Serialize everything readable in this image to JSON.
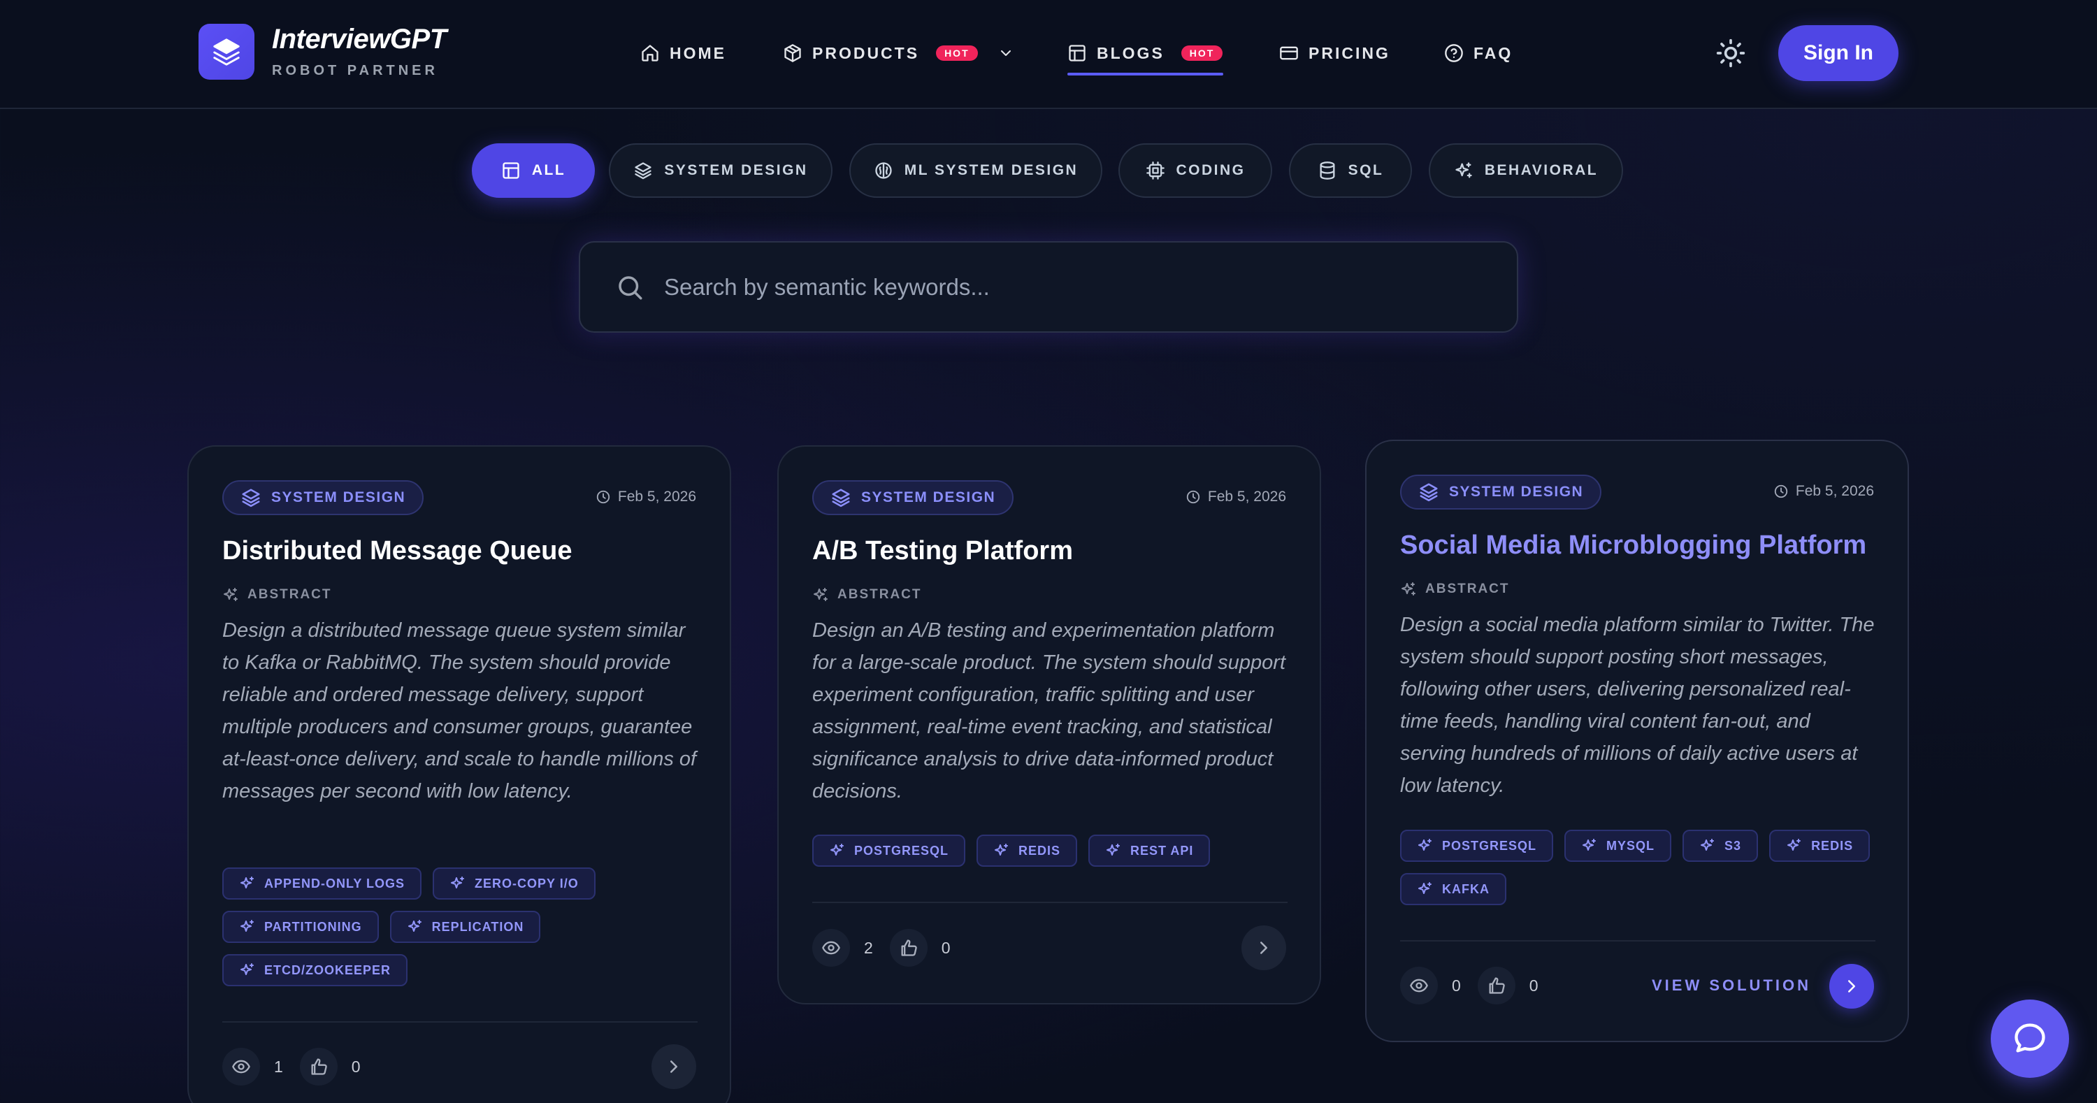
{
  "brand": {
    "title": "InterviewGPT",
    "subtitle": "ROBOT PARTNER"
  },
  "nav": {
    "home": "HOME",
    "products": "PRODUCTS",
    "blogs": "BLOGS",
    "pricing": "PRICING",
    "faq": "FAQ",
    "hot_badge": "HOT",
    "sign_in": "Sign In"
  },
  "filters": [
    "ALL",
    "SYSTEM DESIGN",
    "ML SYSTEM DESIGN",
    "CODING",
    "SQL",
    "BEHAVIORAL"
  ],
  "search": {
    "placeholder": "Search by semantic keywords..."
  },
  "cards": [
    {
      "category": "SYSTEM DESIGN",
      "date": "Feb 5, 2026",
      "title": "Distributed Message Queue",
      "abstract_label": "ABSTRACT",
      "description": "Design a distributed message queue system similar to Kafka or RabbitMQ. The system should provide reliable and ordered message delivery, support multiple producers and consumer groups, guarantee at-least-once delivery, and scale to handle millions of messages per second with low latency.",
      "tags": [
        "APPEND-ONLY LOGS",
        "ZERO-COPY I/O",
        "PARTITIONING",
        "REPLICATION",
        "ETCD/ZOOKEEPER"
      ],
      "views": "1",
      "likes": "0"
    },
    {
      "category": "SYSTEM DESIGN",
      "date": "Feb 5, 2026",
      "title": "A/B Testing Platform",
      "abstract_label": "ABSTRACT",
      "description": "Design an A/B testing and experimentation platform for a large-scale product. The system should support experiment configuration, traffic splitting and user assignment, real-time event tracking, and statistical significance analysis to drive data-informed product decisions.",
      "tags": [
        "POSTGRESQL",
        "REDIS",
        "REST API"
      ],
      "views": "2",
      "likes": "0"
    },
    {
      "category": "SYSTEM DESIGN",
      "date": "Feb 5, 2026",
      "title": "Social Media Microblogging Platform",
      "abstract_label": "ABSTRACT",
      "description": "Design a social media platform similar to Twitter. The system should support posting short messages, following other users, delivering personalized real-time feeds, handling viral content fan-out, and serving hundreds of millions of daily active users at low latency.",
      "tags": [
        "POSTGRESQL",
        "MYSQL",
        "S3",
        "REDIS",
        "KAFKA"
      ],
      "views": "0",
      "likes": "0",
      "view_solution": "VIEW SOLUTION"
    }
  ],
  "colors": {
    "accent": "#4f46e5",
    "hot": "#f0245b",
    "background": "#0a0f1e",
    "card": "#0f1626"
  },
  "icons": {
    "logo": "layers-icon",
    "home": "home-icon",
    "products": "box-icon",
    "blogs": "layout-icon",
    "pricing": "credit-card-icon",
    "faq": "help-circle-icon",
    "theme": "sun-icon",
    "search": "search-icon",
    "chat": "chat-icon",
    "views": "eye-icon",
    "likes": "thumbs-up-icon"
  }
}
